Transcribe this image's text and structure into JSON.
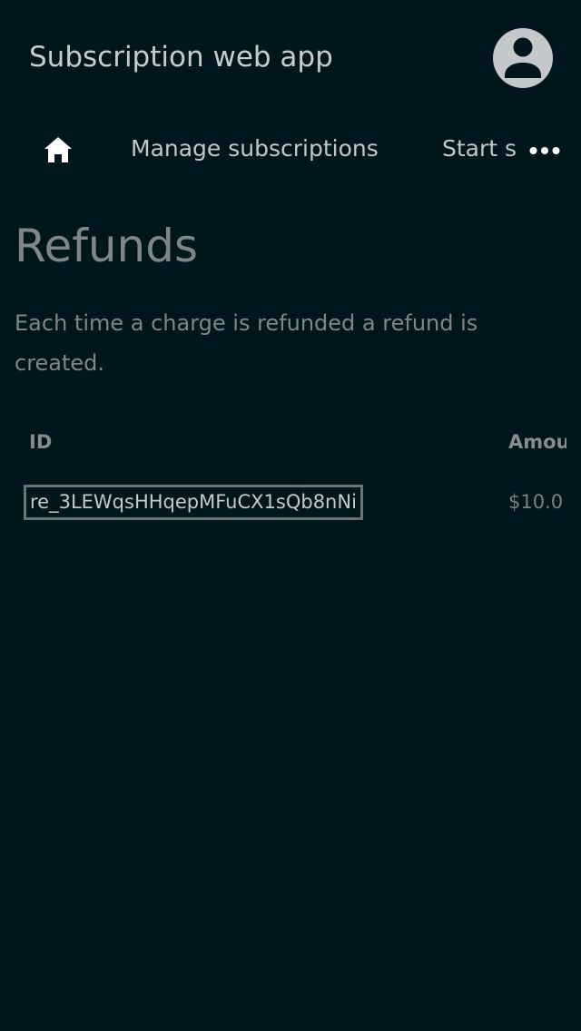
{
  "header": {
    "title": "Subscription web app"
  },
  "nav": {
    "manage_label": "Manage subscriptions",
    "start_label": "Start s"
  },
  "page": {
    "title": "Refunds",
    "description": "Each time a charge is refunded a refund is created."
  },
  "table": {
    "columns": [
      "ID",
      "Amou"
    ],
    "rows": [
      {
        "id": "re_3LEWqsHHqepMFuCX1sQb8nNi",
        "amount": "$10.0"
      }
    ]
  },
  "icons": {
    "account": "account-circle-icon",
    "home": "home-icon",
    "more": "more-horizontal-icon"
  },
  "colors": {
    "background": "#00161d",
    "text": "#c2c9cc",
    "muted_text": "#7d8789",
    "focus_border": "#6a7478"
  }
}
